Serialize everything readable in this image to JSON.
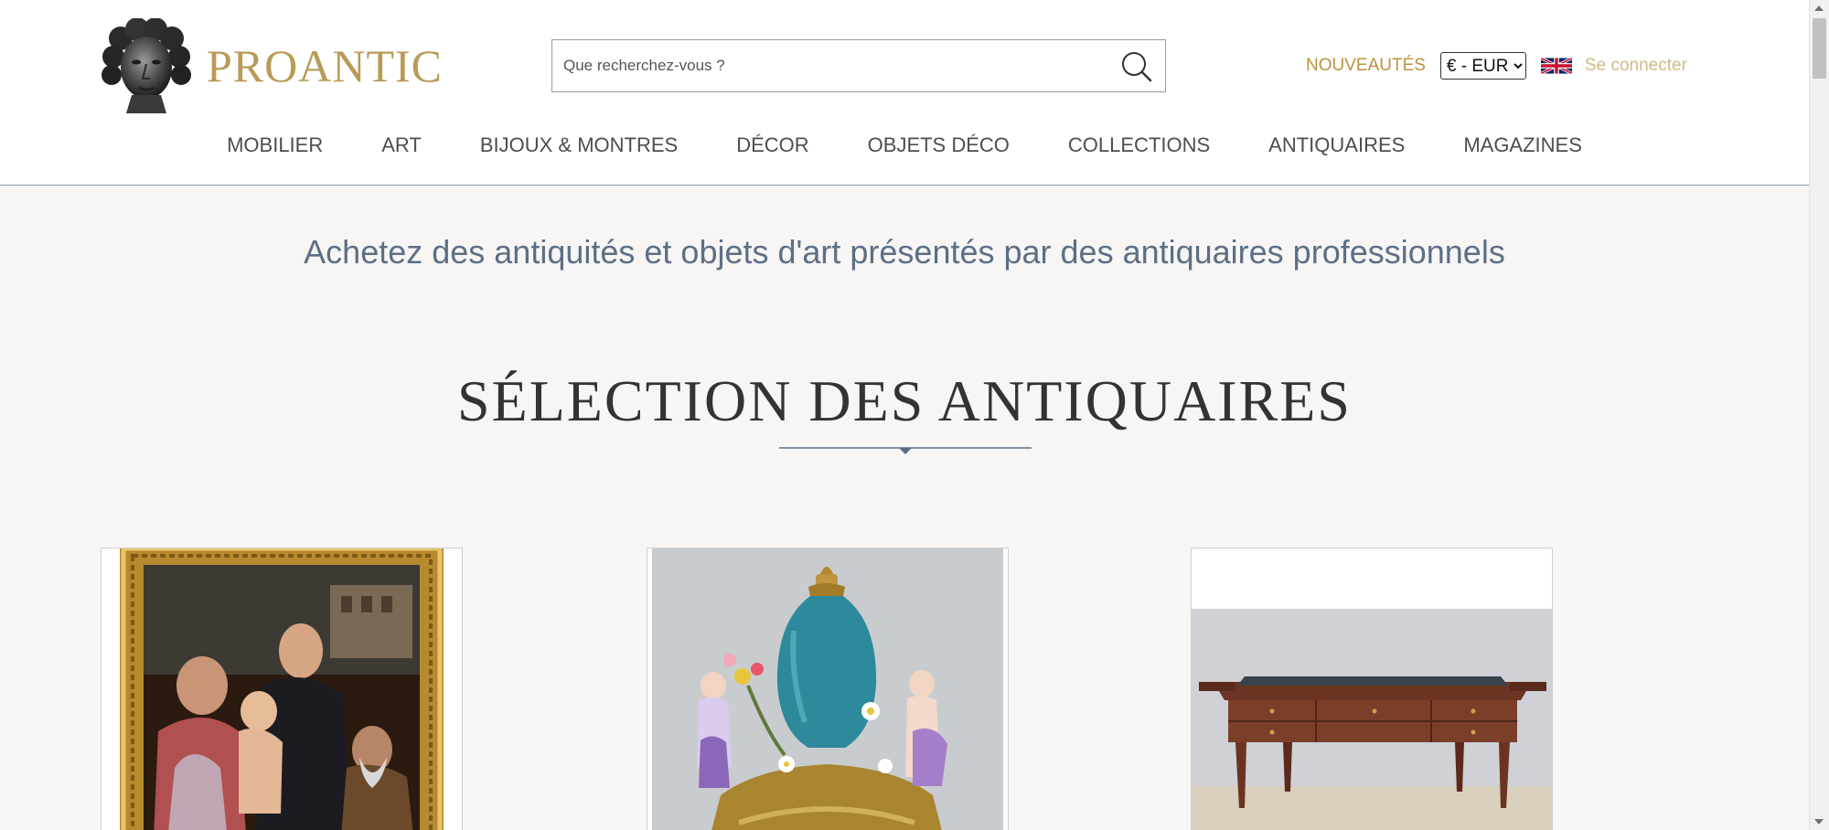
{
  "header": {
    "logo_text": "PROANTIC",
    "logo_icon": "classical-bust-logo",
    "search": {
      "placeholder": "Que recherchez-vous ?",
      "value": "",
      "icon": "search-icon"
    },
    "new_link": "NOUVEAUTÉS",
    "currency": {
      "selected": "€ - EUR",
      "options": [
        "€ - EUR"
      ]
    },
    "language_flag": "uk-flag-icon",
    "login_link": "Se connecter"
  },
  "nav": {
    "items": [
      {
        "label": "MOBILIER"
      },
      {
        "label": "ART"
      },
      {
        "label": "BIJOUX & MONTRES"
      },
      {
        "label": "DÉCOR"
      },
      {
        "label": "OBJETS DÉCO"
      },
      {
        "label": "COLLECTIONS"
      },
      {
        "label": "ANTIQUAIRES"
      },
      {
        "label": "MAGAZINES"
      }
    ]
  },
  "main": {
    "tagline": "Achetez des antiquités et objets d'art présentés par des antiquaires professionnels",
    "section_title": "SÉLECTION DES ANTIQUAIRES",
    "cards": [
      {
        "image": "renaissance-painting-gilt-frame"
      },
      {
        "image": "porcelain-vase-with-cherubs"
      },
      {
        "image": "louis-xvi-mahogany-desk"
      }
    ]
  },
  "colors": {
    "brand_gold": "#b99a57",
    "nav_text": "#4d4d4d",
    "tagline": "#5c6f85",
    "background": "#f7f6f5",
    "divider": "#5b6e85"
  }
}
